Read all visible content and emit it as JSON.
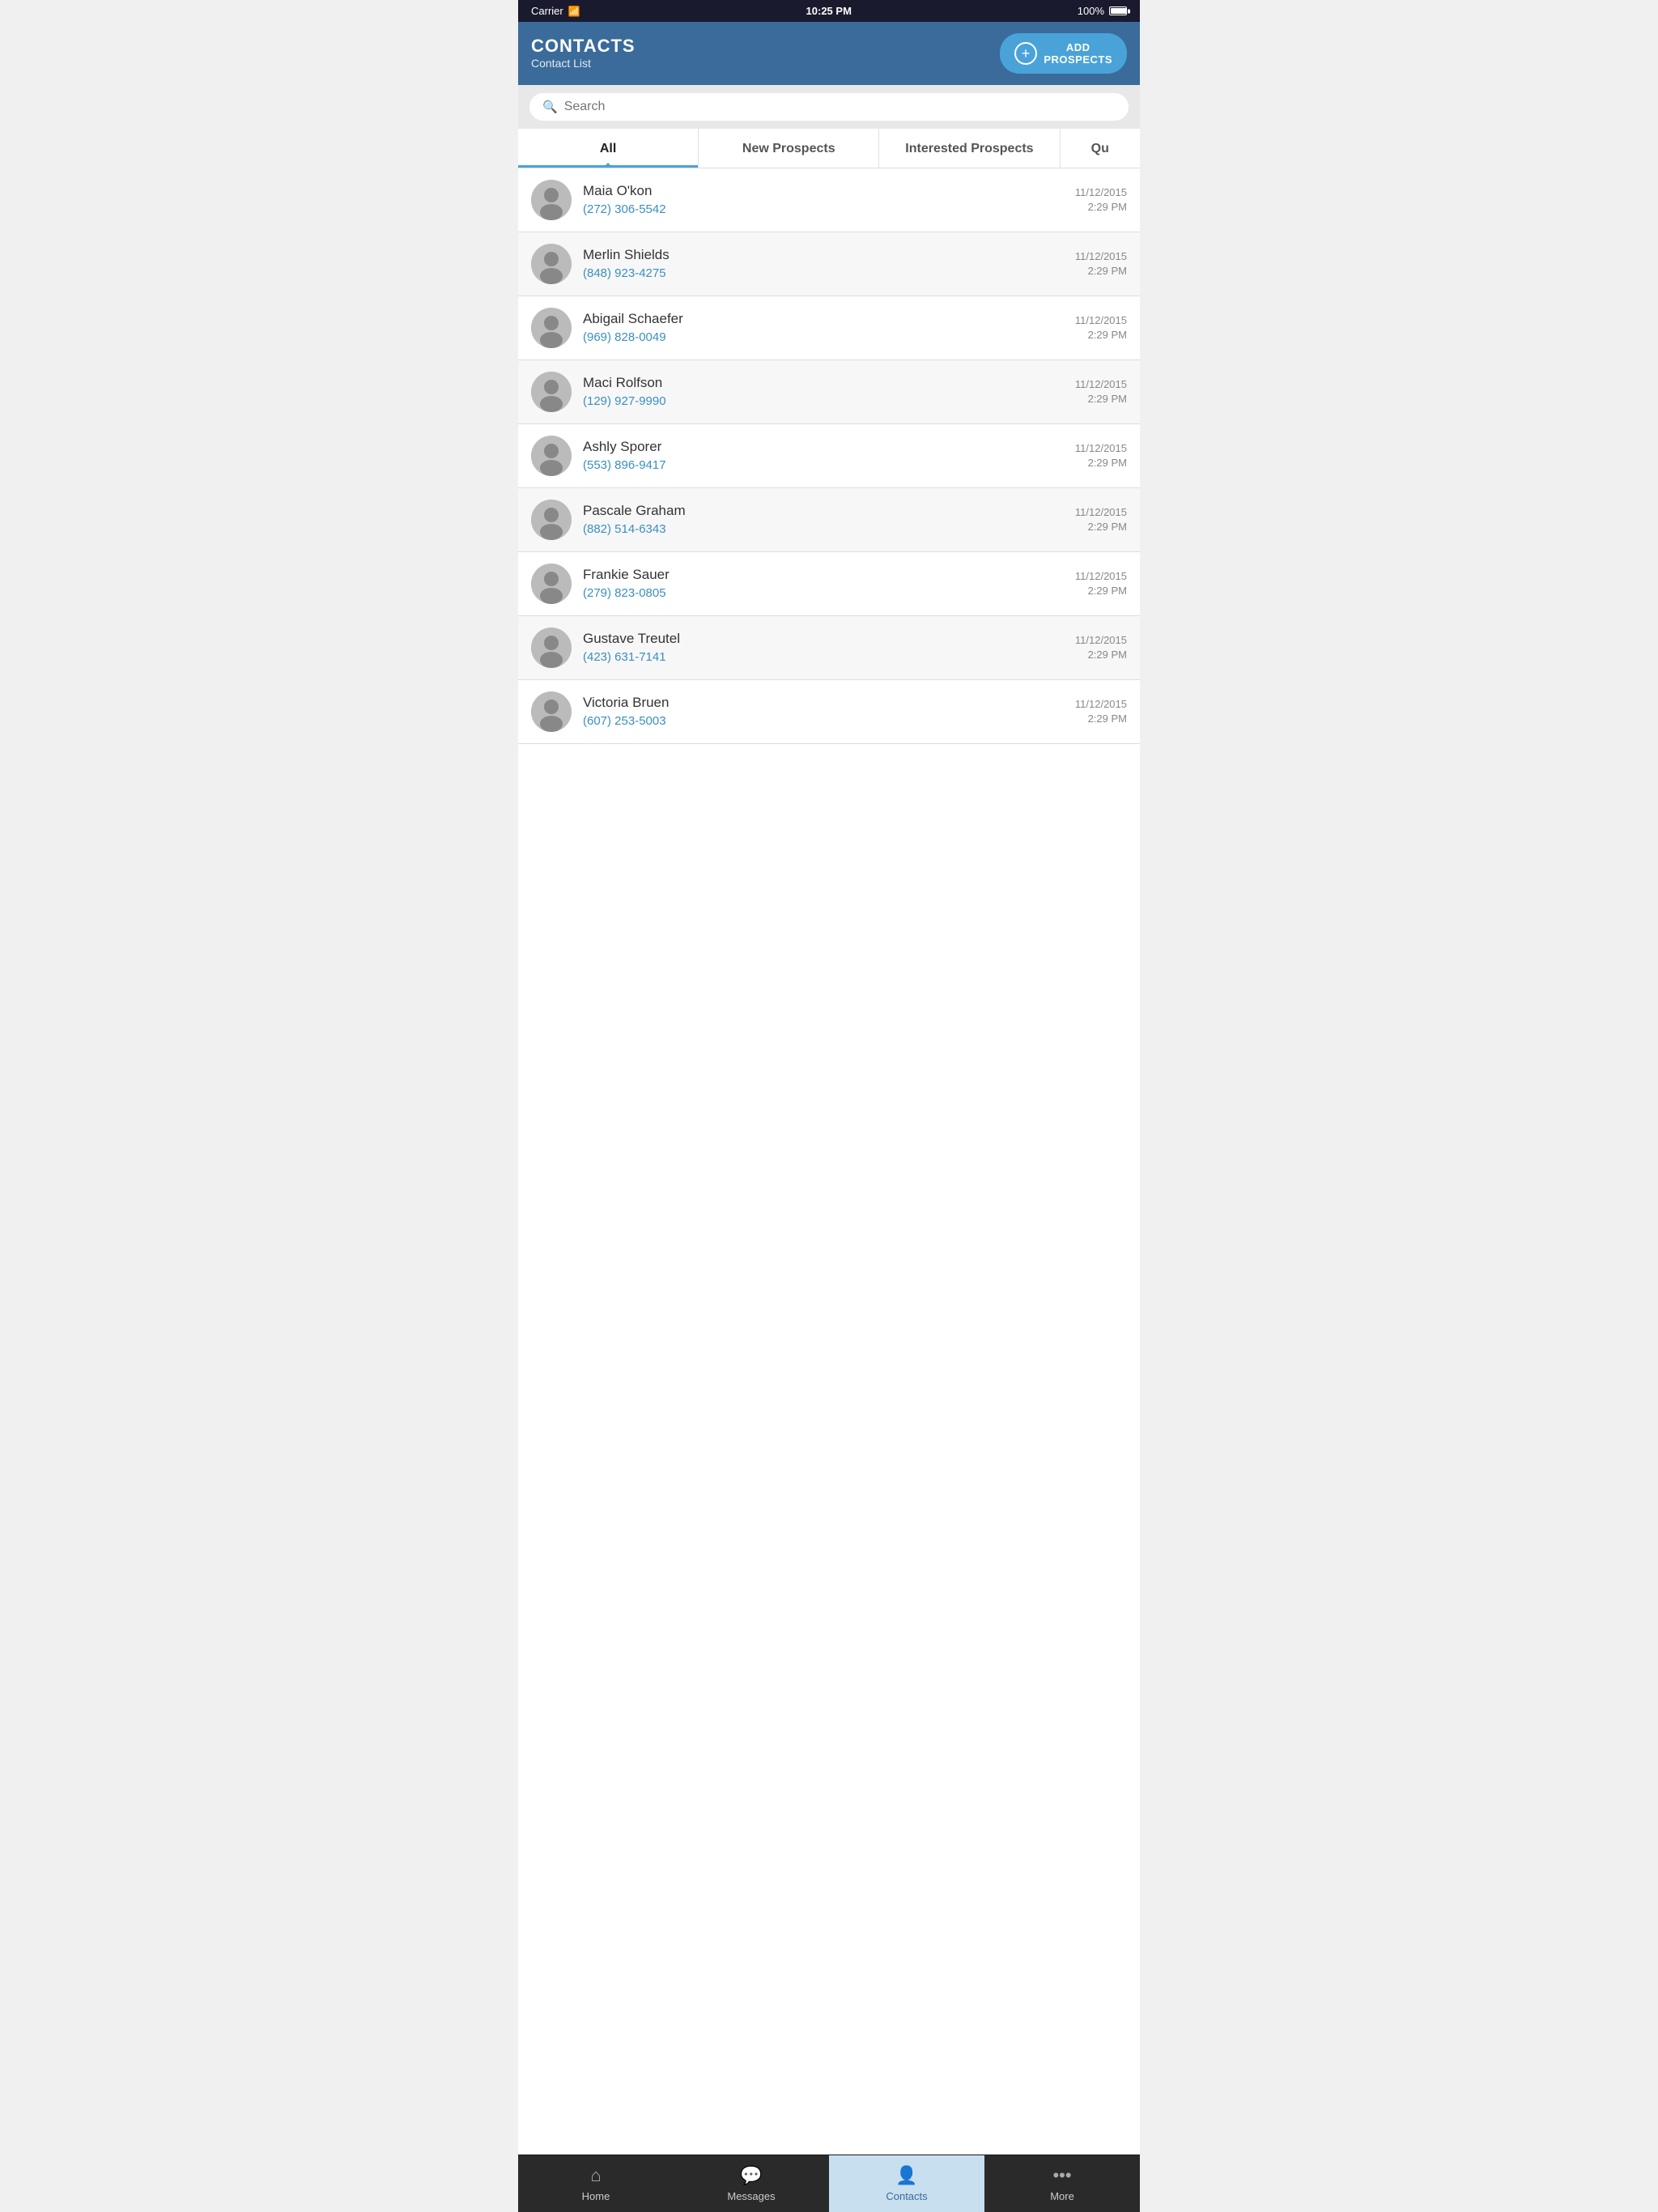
{
  "statusBar": {
    "carrier": "Carrier",
    "time": "10:25 PM",
    "battery": "100%"
  },
  "header": {
    "appName": "CONTACTS",
    "subTitle": "Contact List",
    "addButton": "ADD\nPROSPECTS"
  },
  "search": {
    "placeholder": "Search"
  },
  "tabs": [
    {
      "label": "All",
      "active": true
    },
    {
      "label": "New Prospects",
      "active": false
    },
    {
      "label": "Interested Prospects",
      "active": false
    },
    {
      "label": "Qu",
      "active": false,
      "partial": true
    }
  ],
  "contacts": [
    {
      "name": "Maia O'kon",
      "phone": "(272) 306-5542",
      "date": "11/12/2015",
      "time": "2:29 PM"
    },
    {
      "name": "Merlin Shields",
      "phone": "(848) 923-4275",
      "date": "11/12/2015",
      "time": "2:29 PM"
    },
    {
      "name": "Abigail Schaefer",
      "phone": "(969) 828-0049",
      "date": "11/12/2015",
      "time": "2:29 PM"
    },
    {
      "name": "Maci Rolfson",
      "phone": "(129) 927-9990",
      "date": "11/12/2015",
      "time": "2:29 PM"
    },
    {
      "name": "Ashly Sporer",
      "phone": "(553) 896-9417",
      "date": "11/12/2015",
      "time": "2:29 PM"
    },
    {
      "name": "Pascale Graham",
      "phone": "(882) 514-6343",
      "date": "11/12/2015",
      "time": "2:29 PM"
    },
    {
      "name": "Frankie Sauer",
      "phone": "(279) 823-0805",
      "date": "11/12/2015",
      "time": "2:29 PM"
    },
    {
      "name": "Gustave Treutel",
      "phone": "(423) 631-7141",
      "date": "11/12/2015",
      "time": "2:29 PM"
    },
    {
      "name": "Victoria Bruen",
      "phone": "(607) 253-5003",
      "date": "11/12/2015",
      "time": "2:29 PM"
    }
  ],
  "bottomNav": [
    {
      "label": "Home",
      "icon": "home",
      "active": false
    },
    {
      "label": "Messages",
      "icon": "messages",
      "active": false
    },
    {
      "label": "Contacts",
      "icon": "contacts",
      "active": true
    },
    {
      "label": "More",
      "icon": "more",
      "active": false
    }
  ]
}
